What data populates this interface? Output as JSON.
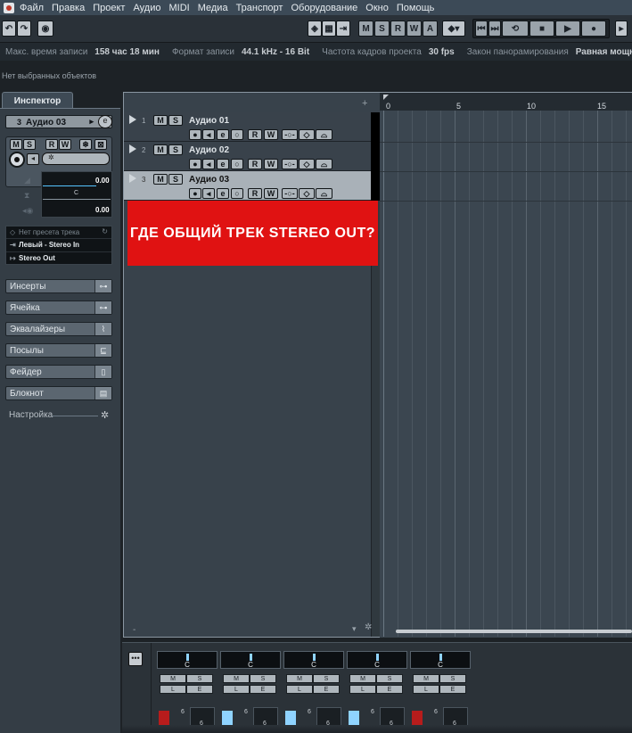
{
  "menu": [
    "Файл",
    "Правка",
    "Проект",
    "Аудио",
    "MIDI",
    "Медиа",
    "Транспорт",
    "Оборудование",
    "Окно",
    "Помощь"
  ],
  "toolbar": {
    "modes": [
      "M",
      "S",
      "R",
      "W",
      "A"
    ]
  },
  "info": {
    "max_rec_label": "Макс. время записи",
    "max_rec_value": "158 час 18 мин",
    "rec_format_label": "Формат записи",
    "rec_format_value": "44.1 kHz - 16 Bit",
    "fps_label": "Частота кадров проекта",
    "fps_value": "30 fps",
    "pan_law_label": "Закон панорамирования",
    "pan_law_value": "Равная мощность"
  },
  "status": "Нет выбранных объектов",
  "inspector": {
    "tab": "Инспектор",
    "track_num": "3",
    "track_name": "Аудио 03",
    "buttons": [
      "M",
      "S",
      "R",
      "W"
    ],
    "vol_value": "0.00",
    "pan_value": "C",
    "delay_value": "0.00",
    "preset": "Нет пресета трека",
    "input": "Левый - Stereo In",
    "output": "Stereo Out",
    "sections": [
      "Инсерты",
      "Ячейка",
      "Эквалайзеры",
      "Посылы",
      "Фейдер",
      "Блокнот"
    ],
    "settings": "Настройка"
  },
  "tracks": [
    {
      "num": "1",
      "name": "Аудио 01",
      "selected": false
    },
    {
      "num": "2",
      "name": "Аудио 02",
      "selected": false
    },
    {
      "num": "3",
      "name": "Аудио 03",
      "selected": true
    }
  ],
  "banner": "ГДЕ ОБЩИЙ ТРЕК STEREO OUT?",
  "ruler": [
    "0",
    "5",
    "10",
    "15"
  ],
  "mixer": {
    "pan": "C",
    "ch_buttons": [
      "M",
      "S",
      "L",
      "E"
    ],
    "fader_scale": [
      "6",
      "0"
    ]
  },
  "colors": {
    "accent_red": "#e01212",
    "selected_track": "#a9b1b8",
    "menubar": "#3c4a57"
  }
}
